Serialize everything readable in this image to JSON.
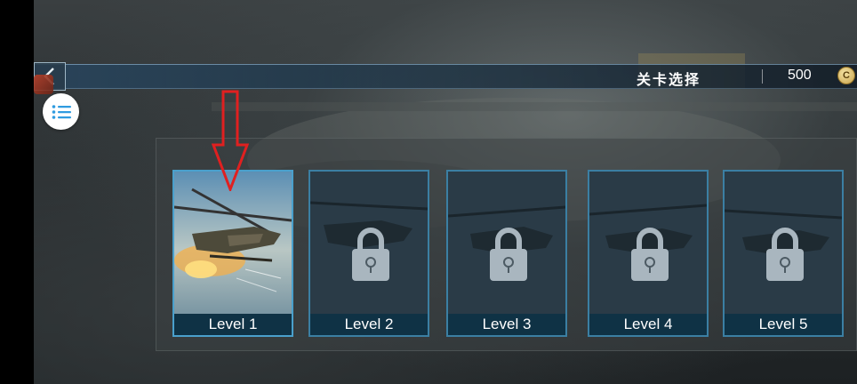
{
  "header": {
    "title": "关卡选择",
    "coins": "500",
    "coin_symbol": "C"
  },
  "levels": [
    {
      "label": "Level 1",
      "locked": false
    },
    {
      "label": "Level 2",
      "locked": true
    },
    {
      "label": "Level 3",
      "locked": true
    },
    {
      "label": "Level 4",
      "locked": true
    },
    {
      "label": "Level 5",
      "locked": true
    }
  ],
  "colors": {
    "card_border": "#3b7fa3",
    "label_bg": "#0f3245",
    "lock": "#a9b6bf",
    "annotation_arrow": "#e02020"
  }
}
